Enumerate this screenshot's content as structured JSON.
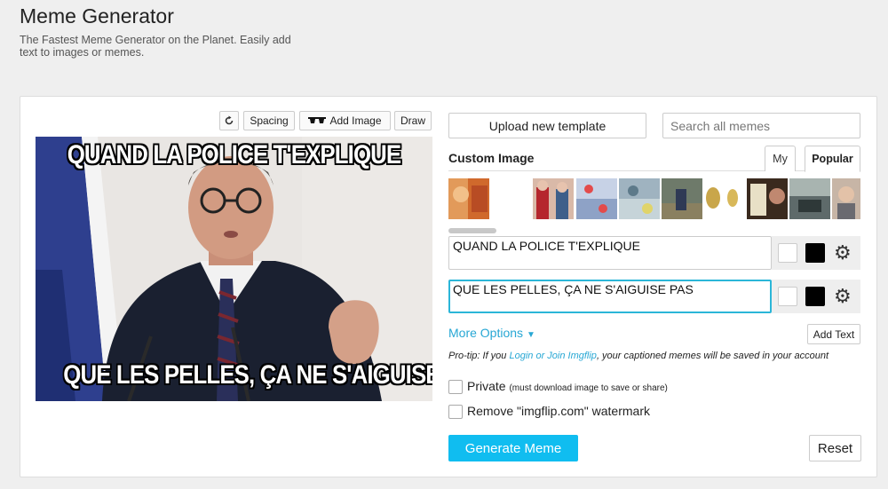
{
  "header": {
    "title": "Meme Generator",
    "subtitle": "The Fastest Meme Generator on the Planet. Easily add text to images or memes."
  },
  "toolbar": {
    "rotate_icon": "rotate-icon",
    "spacing_label": "Spacing",
    "add_image_icon": "sunglasses-icon",
    "add_image_label": "Add Image",
    "draw_label": "Draw"
  },
  "meme": {
    "top_text": "QUAND LA POLICE T'EXPLIQUE",
    "bottom_text": "QUE LES PELLES, ÇA NE S'AIGUISE PAS"
  },
  "right": {
    "upload_label": "Upload new template",
    "search_placeholder": "Search all memes",
    "custom_image_label": "Custom Image",
    "tabs": [
      {
        "label": "My"
      },
      {
        "label": "Popular"
      }
    ],
    "active_tab": "Popular",
    "text_boxes": [
      {
        "value": "QUAND LA POLICE T'EXPLIQUE"
      },
      {
        "value": "QUE LES PELLES, ÇA NE S'AIGUISE PAS"
      }
    ],
    "more_options_label": "More Options",
    "add_text_label": "Add Text",
    "protip_prefix": "Pro-tip: If you ",
    "protip_link": "Login or Join Imgflip",
    "protip_suffix": ", your captioned memes will be saved in your account",
    "private_label": "Private",
    "private_note": "(must download image to save or share)",
    "watermark_label": "Remove \"imgflip.com\" watermark",
    "generate_label": "Generate Meme",
    "reset_label": "Reset"
  },
  "colors": {
    "accent": "#10bdf0",
    "link": "#27a7d4",
    "active_border": "#2bb6d8"
  }
}
